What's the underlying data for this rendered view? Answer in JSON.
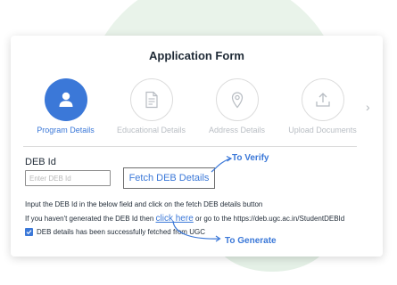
{
  "form": {
    "title": "Application Form",
    "steps": [
      {
        "label": "Program Details",
        "icon": "user-icon",
        "active": true
      },
      {
        "label": "Educational Details",
        "icon": "document-icon",
        "active": false
      },
      {
        "label": "Address Details",
        "icon": "location-pin-icon",
        "active": false
      },
      {
        "label": "Upload Documents",
        "icon": "upload-icon",
        "active": false
      }
    ],
    "next_icon": "chevron-right-icon"
  },
  "deb": {
    "label": "DEB Id",
    "input_value": "",
    "input_placeholder": "Enter DEB Id",
    "fetch_button_label": "Fetch DEB Details"
  },
  "instructions": {
    "line1": "Input the DEB Id in the below field and click on the fetch DEB details button",
    "line2_prefix": "If you haven't generated the DEB Id then ",
    "click_here": "click here",
    "line2_suffix": " or go to the https://deb.ugc.ac.in/StudentDEBId"
  },
  "status": {
    "checked": true,
    "message": "DEB details has been successfully fetched from UGC"
  },
  "annotations": {
    "verify": "To Verify",
    "generate": "To Generate"
  },
  "colors": {
    "accent": "#3b78d8",
    "background_circle": "#e9f3ea",
    "inactive": "#b9bec4"
  }
}
